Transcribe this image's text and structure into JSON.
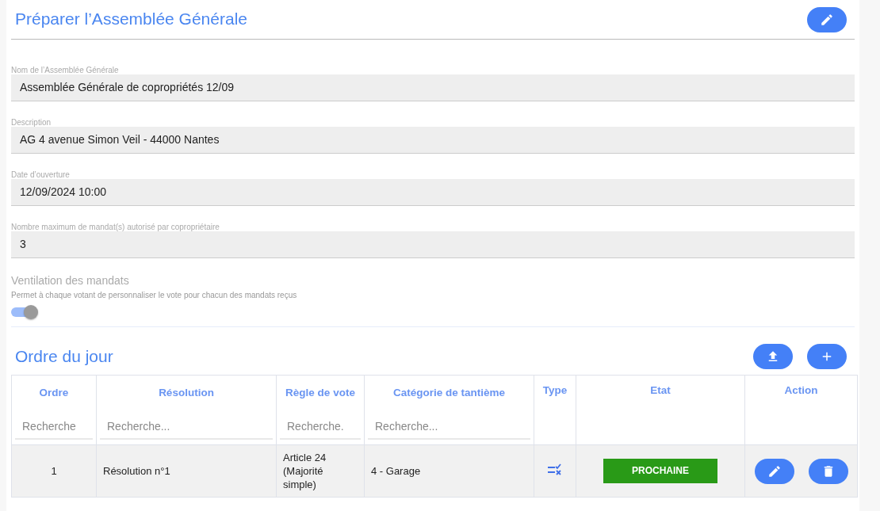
{
  "header": {
    "title": "Préparer l’Assemblée Générale"
  },
  "fields": [
    {
      "label": "Nom de l’Assemblée Générale",
      "value": "Assemblée Générale de copropriétés 12/09"
    },
    {
      "label": "Description",
      "value": "AG 4 avenue Simon Veil - 44000 Nantes"
    },
    {
      "label": "Date d’ouverture",
      "value": "12/09/2024 10:00"
    },
    {
      "label": "Nombre maximum de mandat(s) autorisé par copropriétaire",
      "value": "3"
    }
  ],
  "ventilation": {
    "title": "Ventilation des mandats",
    "description": "Permet à chaque votant de personnaliser le vote pour chacun des mandats reçus",
    "on": true
  },
  "agenda": {
    "title": "Ordre du jour",
    "columns": [
      {
        "label": "Ordre",
        "placeholder": "Recherche"
      },
      {
        "label": "Résolution",
        "placeholder": "Recherche..."
      },
      {
        "label": "Règle de vote",
        "placeholder": "Recherche."
      },
      {
        "label": "Catégorie de tantième",
        "placeholder": "Recherche..."
      },
      {
        "label": "Type"
      },
      {
        "label": "Etat"
      },
      {
        "label": "Action"
      }
    ],
    "rows": [
      {
        "order": "1",
        "resolution": "Résolution n°1",
        "rule": "Article 24 (Majorité simple)",
        "category": "4 - Garage",
        "state": "PROCHAINE",
        "color": "#299a17"
      }
    ]
  }
}
